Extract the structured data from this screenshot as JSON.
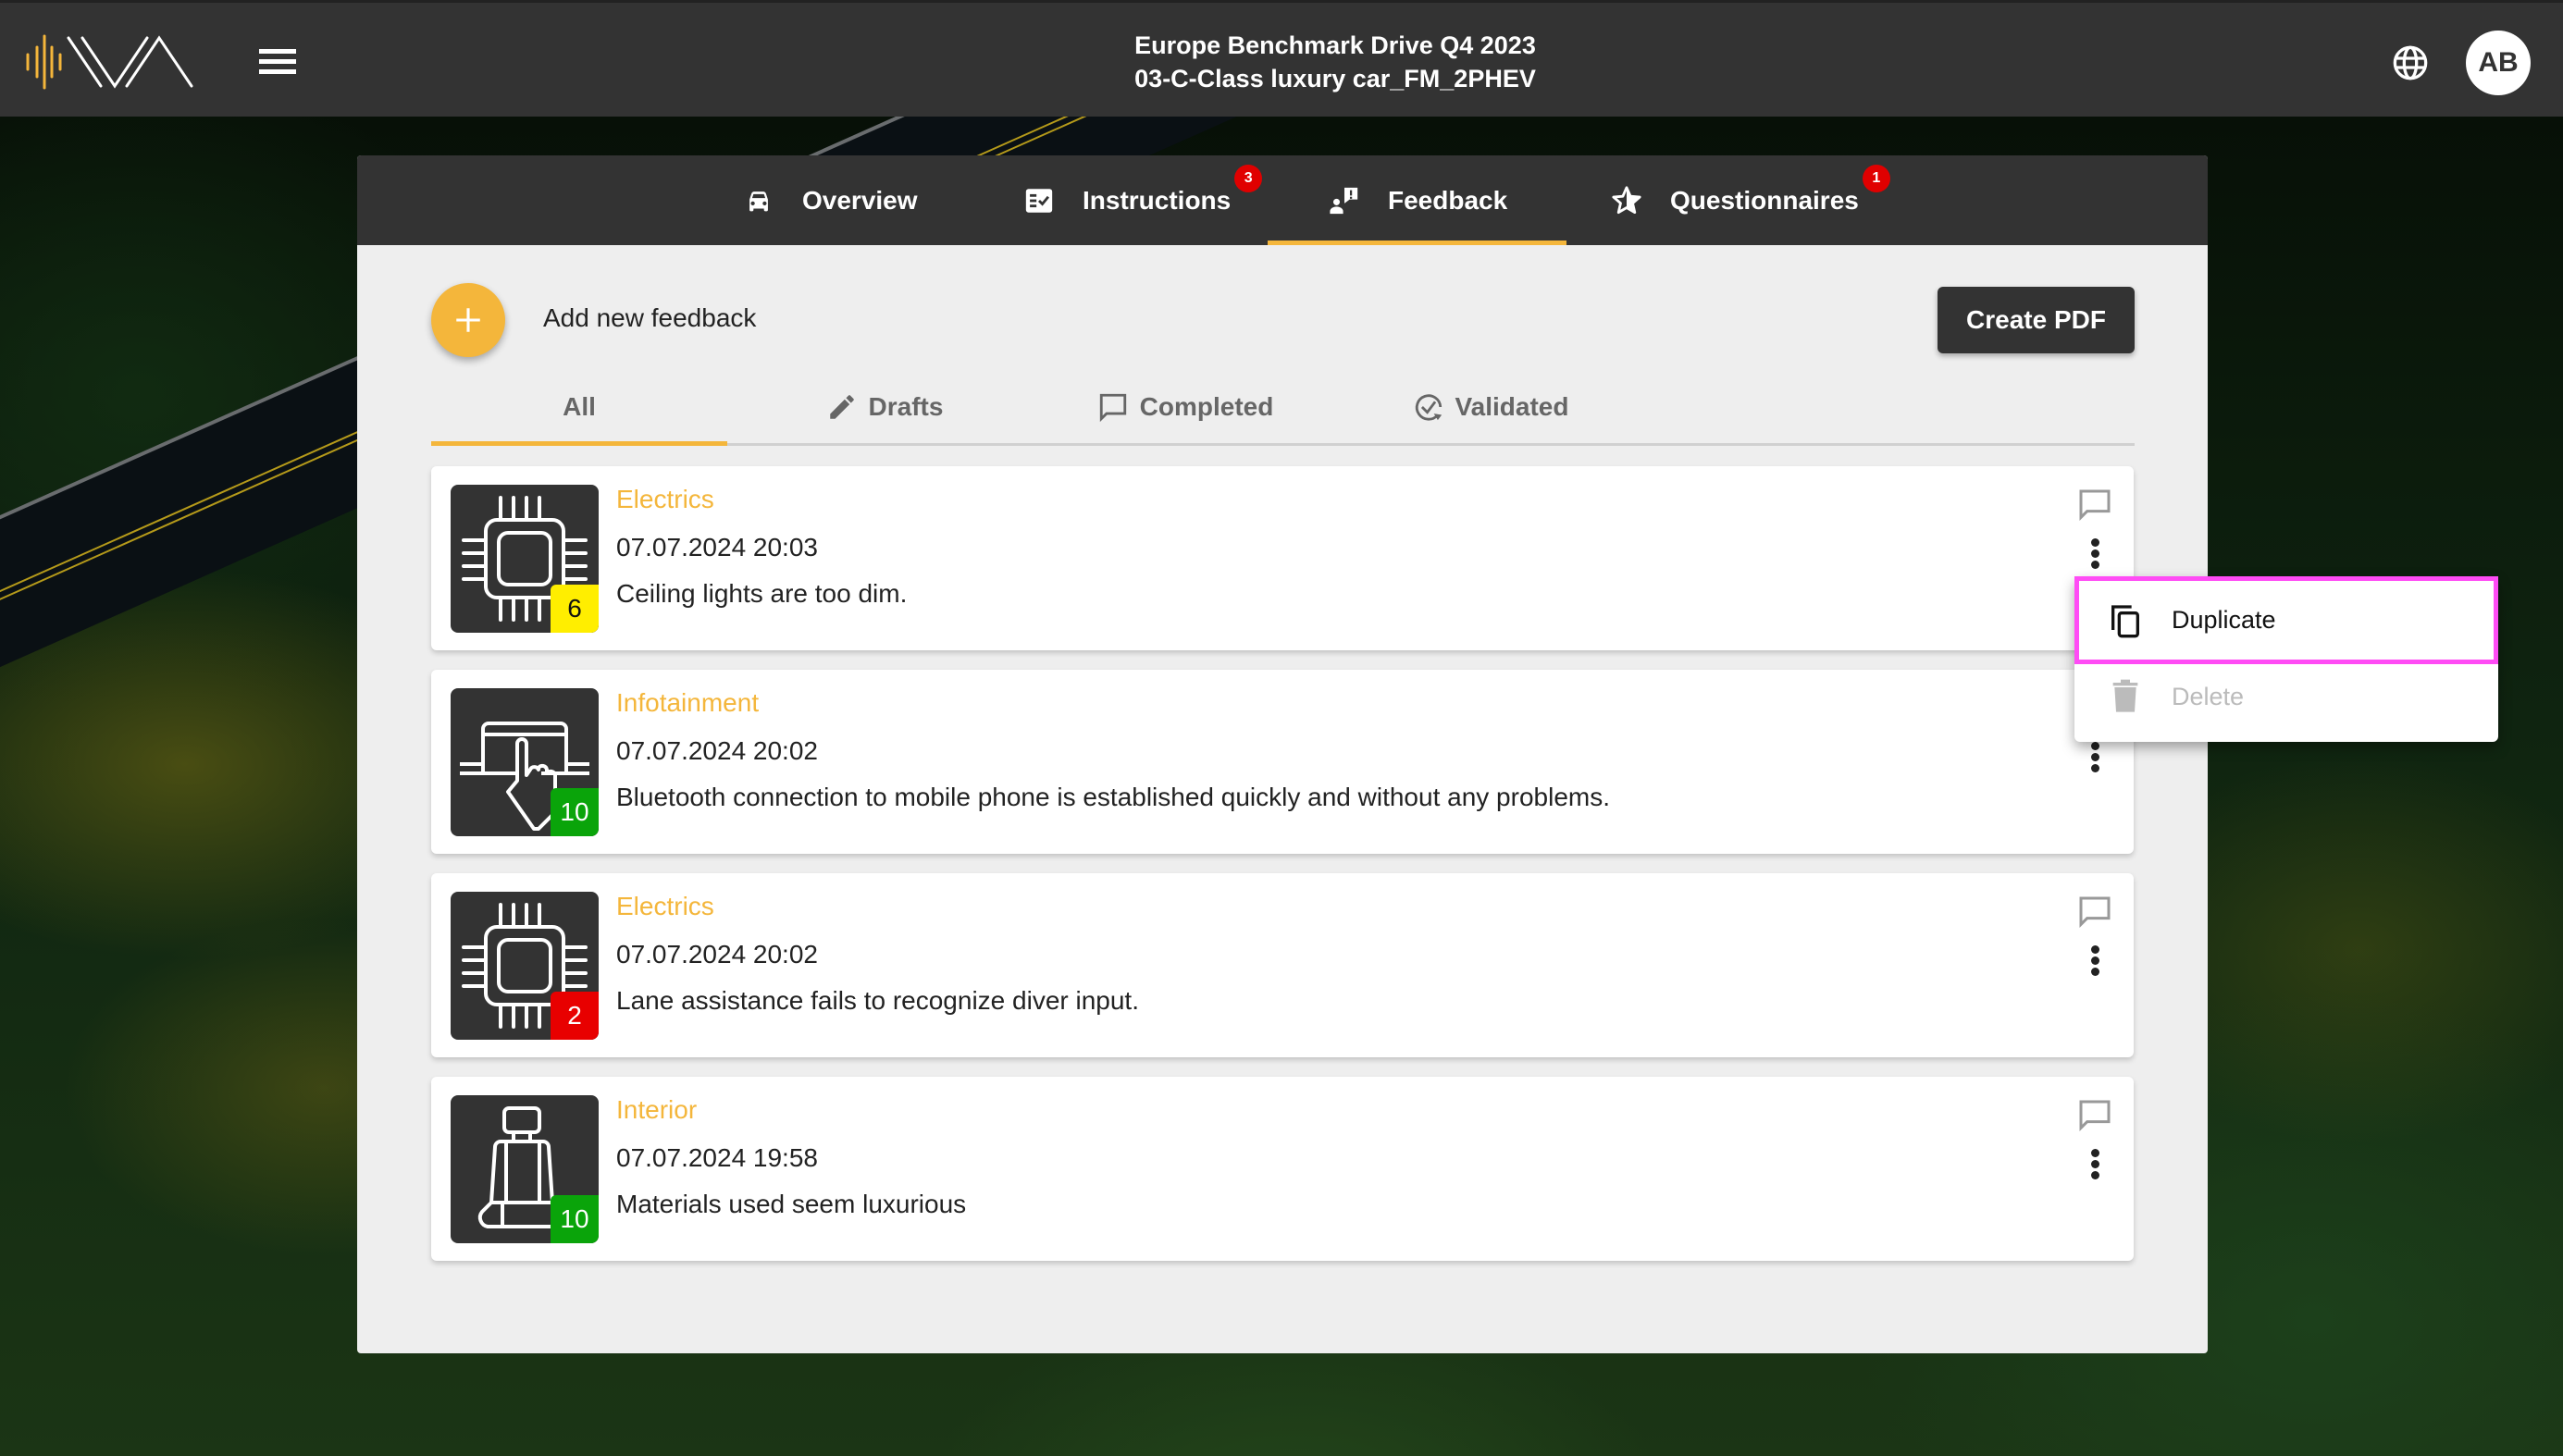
{
  "header": {
    "logo": "IVA logo",
    "menu_icon": "hamburger-menu-icon",
    "title_line1": "Europe Benchmark Drive Q4 2023",
    "title_line2": "03-C-Class luxury car_FM_2PHEV",
    "language_icon": "globe-icon",
    "avatar_initials": "AB"
  },
  "main_tabs": [
    {
      "label": "Overview",
      "icon": "car-icon",
      "badge": null,
      "active": false
    },
    {
      "label": "Instructions",
      "icon": "checklist-icon",
      "badge": "3",
      "active": false
    },
    {
      "label": "Feedback",
      "icon": "feedback-icon",
      "badge": null,
      "active": true
    },
    {
      "label": "Questionnaires",
      "icon": "star-icon",
      "badge": "1",
      "active": false
    }
  ],
  "toolbar": {
    "add_label": "Add new feedback",
    "create_pdf_label": "Create PDF"
  },
  "filter_tabs": [
    {
      "label": "All",
      "icon": null,
      "active": true
    },
    {
      "label": "Drafts",
      "icon": "pencil-icon",
      "active": false
    },
    {
      "label": "Completed",
      "icon": "comment-icon",
      "active": false
    },
    {
      "label": "Validated",
      "icon": "check-circle-icon",
      "active": false
    }
  ],
  "colors": {
    "accent": "#f4b63b",
    "header_bg": "#333333",
    "rating_yellow": "#ffee00",
    "rating_green": "#0aa40a",
    "rating_red": "#e80000",
    "badge_red": "#e00000",
    "highlight": "#ff4cf5"
  },
  "feedback_items": [
    {
      "category": "Electrics",
      "datetime": "07.07.2024 20:03",
      "description": "Ceiling lights are too dim.",
      "icon": "chip-icon",
      "rating": "6",
      "rating_color": "yellow"
    },
    {
      "category": "Infotainment",
      "datetime": "07.07.2024 20:02",
      "description": "Bluetooth connection to mobile phone is established quickly and without any problems.",
      "icon": "touchscreen-icon",
      "rating": "10",
      "rating_color": "green"
    },
    {
      "category": "Electrics",
      "datetime": "07.07.2024 20:02",
      "description": "Lane assistance fails to recognize diver input.",
      "icon": "chip-icon",
      "rating": "2",
      "rating_color": "red"
    },
    {
      "category": "Interior",
      "datetime": "07.07.2024 19:58",
      "description": "Materials used seem luxurious",
      "icon": "seat-icon",
      "rating": "10",
      "rating_color": "green"
    }
  ],
  "context_menu": {
    "items": [
      {
        "label": "Duplicate",
        "icon": "copy-icon",
        "enabled": true,
        "highlighted": true
      },
      {
        "label": "Delete",
        "icon": "trash-icon",
        "enabled": false,
        "highlighted": false
      }
    ]
  }
}
